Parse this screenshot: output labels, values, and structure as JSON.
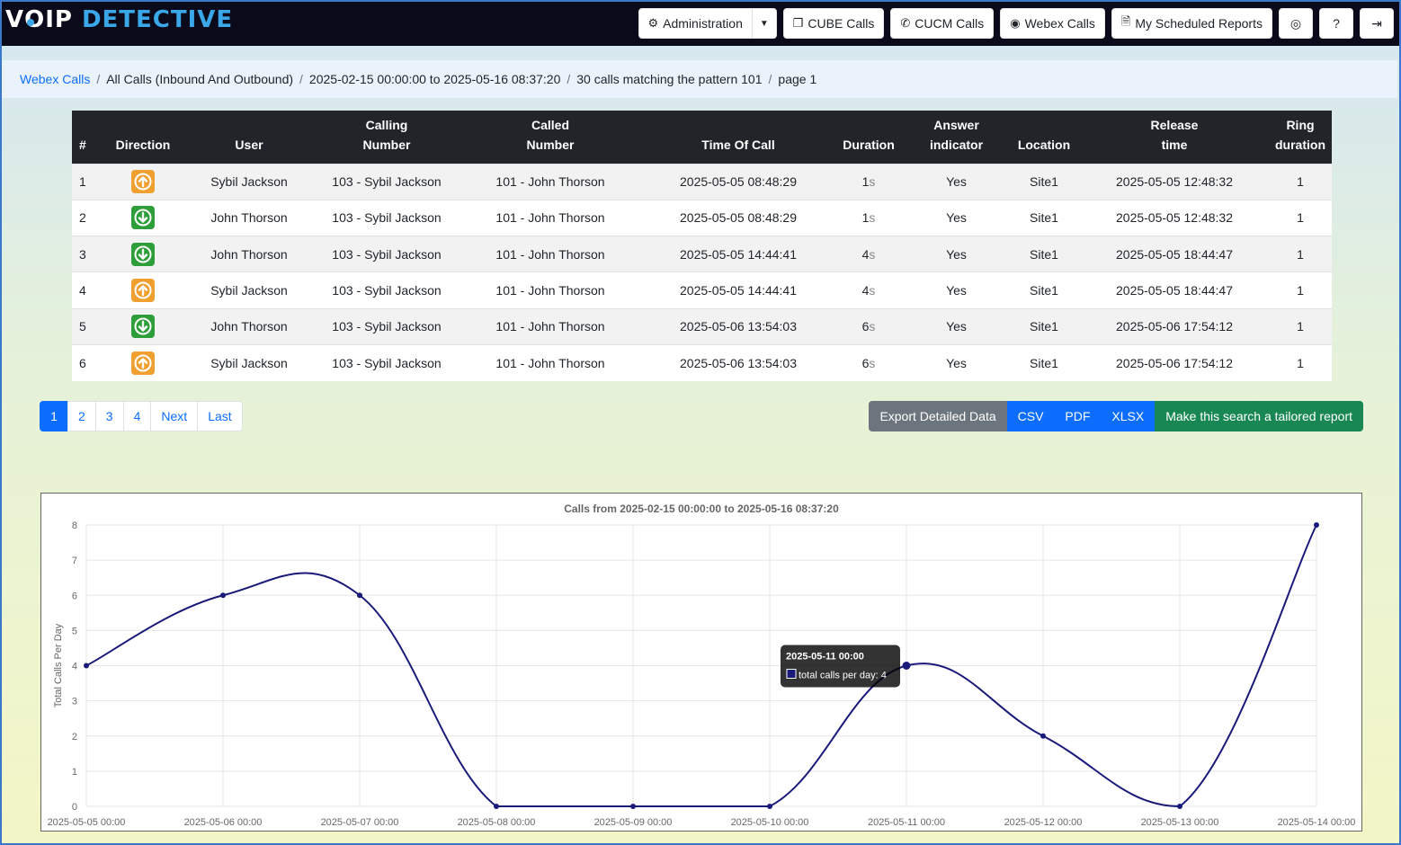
{
  "logo": {
    "part1": "V",
    "part_o": "O",
    "part2": "IP",
    "part3": "DETECTIVE"
  },
  "nav": {
    "administration": "Administration",
    "cube_calls": "CUBE Calls",
    "cucm_calls": "CUCM Calls",
    "webex_calls": "Webex Calls",
    "reports": "My Scheduled Reports"
  },
  "breadcrumb": {
    "root": "Webex Calls",
    "scope": "All Calls (Inbound And Outbound)",
    "range": "2025-02-15 00:00:00 to 2025-05-16 08:37:20",
    "match": "30 calls matching the pattern 101",
    "page": "page 1"
  },
  "table": {
    "headers": {
      "num": "#",
      "direction": "Direction",
      "user": "User",
      "calling_1": "Calling",
      "calling_2": "Number",
      "called_1": "Called",
      "called_2": "Number",
      "time": "Time Of Call",
      "duration": "Duration",
      "answer_1": "Answer",
      "answer_2": "indicator",
      "location": "Location",
      "release_1": "Release",
      "release_2": "time",
      "ring_1": "Ring",
      "ring_2": "duration"
    },
    "rows": [
      {
        "num": "1",
        "direction": "outbound",
        "user": "Sybil Jackson",
        "calling": "103 - Sybil Jackson",
        "called": "101 - John Thorson",
        "time": "2025-05-05 08:48:29",
        "duration": "1",
        "unit": "s",
        "answer": "Yes",
        "location": "Site1",
        "release": "2025-05-05 12:48:32",
        "ring": "1"
      },
      {
        "num": "2",
        "direction": "inbound",
        "user": "John Thorson",
        "calling": "103 - Sybil Jackson",
        "called": "101 - John Thorson",
        "time": "2025-05-05 08:48:29",
        "duration": "1",
        "unit": "s",
        "answer": "Yes",
        "location": "Site1",
        "release": "2025-05-05 12:48:32",
        "ring": "1"
      },
      {
        "num": "3",
        "direction": "inbound",
        "user": "John Thorson",
        "calling": "103 - Sybil Jackson",
        "called": "101 - John Thorson",
        "time": "2025-05-05 14:44:41",
        "duration": "4",
        "unit": "s",
        "answer": "Yes",
        "location": "Site1",
        "release": "2025-05-05 18:44:47",
        "ring": "1"
      },
      {
        "num": "4",
        "direction": "outbound",
        "user": "Sybil Jackson",
        "calling": "103 - Sybil Jackson",
        "called": "101 - John Thorson",
        "time": "2025-05-05 14:44:41",
        "duration": "4",
        "unit": "s",
        "answer": "Yes",
        "location": "Site1",
        "release": "2025-05-05 18:44:47",
        "ring": "1"
      },
      {
        "num": "5",
        "direction": "inbound",
        "user": "John Thorson",
        "calling": "103 - Sybil Jackson",
        "called": "101 - John Thorson",
        "time": "2025-05-06 13:54:03",
        "duration": "6",
        "unit": "s",
        "answer": "Yes",
        "location": "Site1",
        "release": "2025-05-06 17:54:12",
        "ring": "1"
      },
      {
        "num": "6",
        "direction": "outbound",
        "user": "Sybil Jackson",
        "calling": "103 - Sybil Jackson",
        "called": "101 - John Thorson",
        "time": "2025-05-06 13:54:03",
        "duration": "6",
        "unit": "s",
        "answer": "Yes",
        "location": "Site1",
        "release": "2025-05-06 17:54:12",
        "ring": "1"
      }
    ]
  },
  "pagination": {
    "p1": "1",
    "p2": "2",
    "p3": "3",
    "p4": "4",
    "next": "Next",
    "last": "Last"
  },
  "export": {
    "label": "Export Detailed Data",
    "csv": "CSV",
    "pdf": "PDF",
    "xlsx": "XLSX",
    "tailored": "Make this search a tailored report"
  },
  "colors": {
    "outbound": "#f0a030",
    "inbound": "#2e9e3a",
    "line": "#1a1a7a",
    "primary": "#0d6efd",
    "success": "#198754"
  },
  "icons": {
    "outbound": "arrow-up-circle-icon",
    "inbound": "arrow-down-circle-icon"
  },
  "chart_data": {
    "type": "line",
    "title": "Calls from 2025-02-15 00:00:00 to 2025-05-16 08:37:20",
    "xlabel": "",
    "ylabel": "Total Calls Per Day",
    "x": [
      "2025-05-05 00:00",
      "2025-05-06 00:00",
      "2025-05-07 00:00",
      "2025-05-08 00:00",
      "2025-05-09 00:00",
      "2025-05-10 00:00",
      "2025-05-11 00:00",
      "2025-05-12 00:00",
      "2025-05-13 00:00",
      "2025-05-14 00:00"
    ],
    "series": [
      {
        "name": "total calls per day",
        "values": [
          4,
          6,
          6,
          0,
          0,
          0,
          4,
          2,
          0,
          8
        ]
      }
    ],
    "ylim": [
      0,
      8
    ],
    "yticks": [
      "0",
      "1",
      "2",
      "3",
      "4",
      "5",
      "6",
      "7",
      "8"
    ],
    "grid": true,
    "tooltip": {
      "title": "2025-05-11 00:00",
      "label": "total calls per day: 4"
    }
  }
}
